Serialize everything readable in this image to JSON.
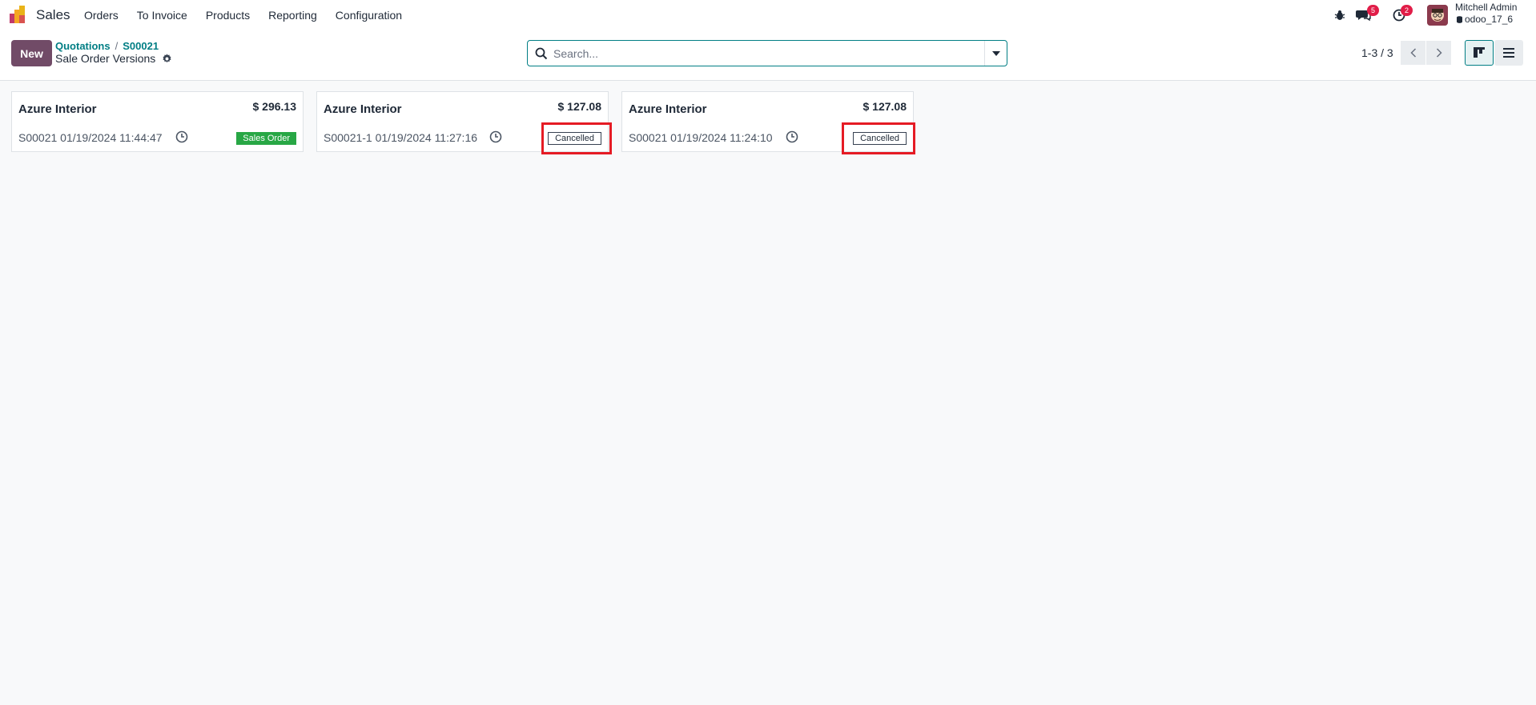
{
  "navbar": {
    "app_name": "Sales",
    "menu": [
      "Orders",
      "To Invoice",
      "Products",
      "Reporting",
      "Configuration"
    ],
    "messages_badge": "5",
    "activities_badge": "2",
    "user_name": "Mitchell Admin",
    "database": "odoo_17_6"
  },
  "control": {
    "new_label": "New",
    "breadcrumb": [
      "Quotations",
      "S00021"
    ],
    "breadcrumb_sep": "/",
    "page_title": "Sale Order Versions",
    "search_placeholder": "Search...",
    "pager": "1-3 / 3"
  },
  "cards": [
    {
      "customer": "Azure Interior",
      "amount": "$ 296.13",
      "ref": "S00021 01/19/2024 11:44:47",
      "status": "Sales Order"
    },
    {
      "customer": "Azure Interior",
      "amount": "$ 127.08",
      "ref": "S00021-1 01/19/2024 11:27:16",
      "status": "Cancelled"
    },
    {
      "customer": "Azure Interior",
      "amount": "$ 127.08",
      "ref": "S00021 01/19/2024 11:24:10",
      "status": "Cancelled"
    }
  ],
  "colors": {
    "brand": "#714b67",
    "link": "#017e84",
    "sales_order": "#28a745",
    "badge": "#e11d48",
    "highlight": "#e51b24"
  }
}
